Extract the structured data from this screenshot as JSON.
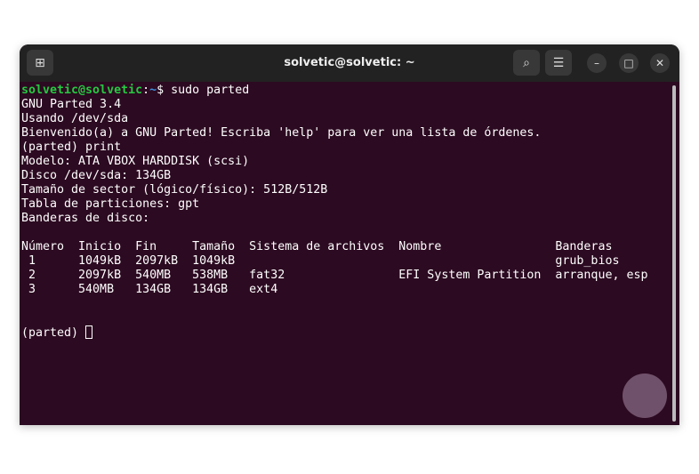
{
  "window": {
    "title": "solvetic@solvetic: ~"
  },
  "prompt": {
    "user": "solvetic@solvetic",
    "sep": ":",
    "path": "~",
    "dollar": "$ ",
    "command": "sudo parted"
  },
  "lines": [
    "GNU Parted 3.4",
    "Usando /dev/sda",
    "Bienvenido(a) a GNU Parted! Escriba 'help' para ver una lista de órdenes.",
    "(parted) print",
    "Modelo: ATA VBOX HARDDISK (scsi)",
    "Disco /dev/sda: 134GB",
    "Tamaño de sector (lógico/físico): 512B/512B",
    "Tabla de particiones: gpt",
    "Banderas de disco:",
    "",
    "Número  Inicio  Fin     Tamaño  Sistema de archivos  Nombre                Banderas",
    " 1      1049kB  2097kB  1049kB                                             grub_bios",
    " 2      2097kB  540MB   538MB   fat32                EFI System Partition  arranque, esp",
    " 3      540MB   134GB   134GB   ext4",
    "",
    ""
  ],
  "final_prompt": "(parted) ",
  "watermark": "?"
}
